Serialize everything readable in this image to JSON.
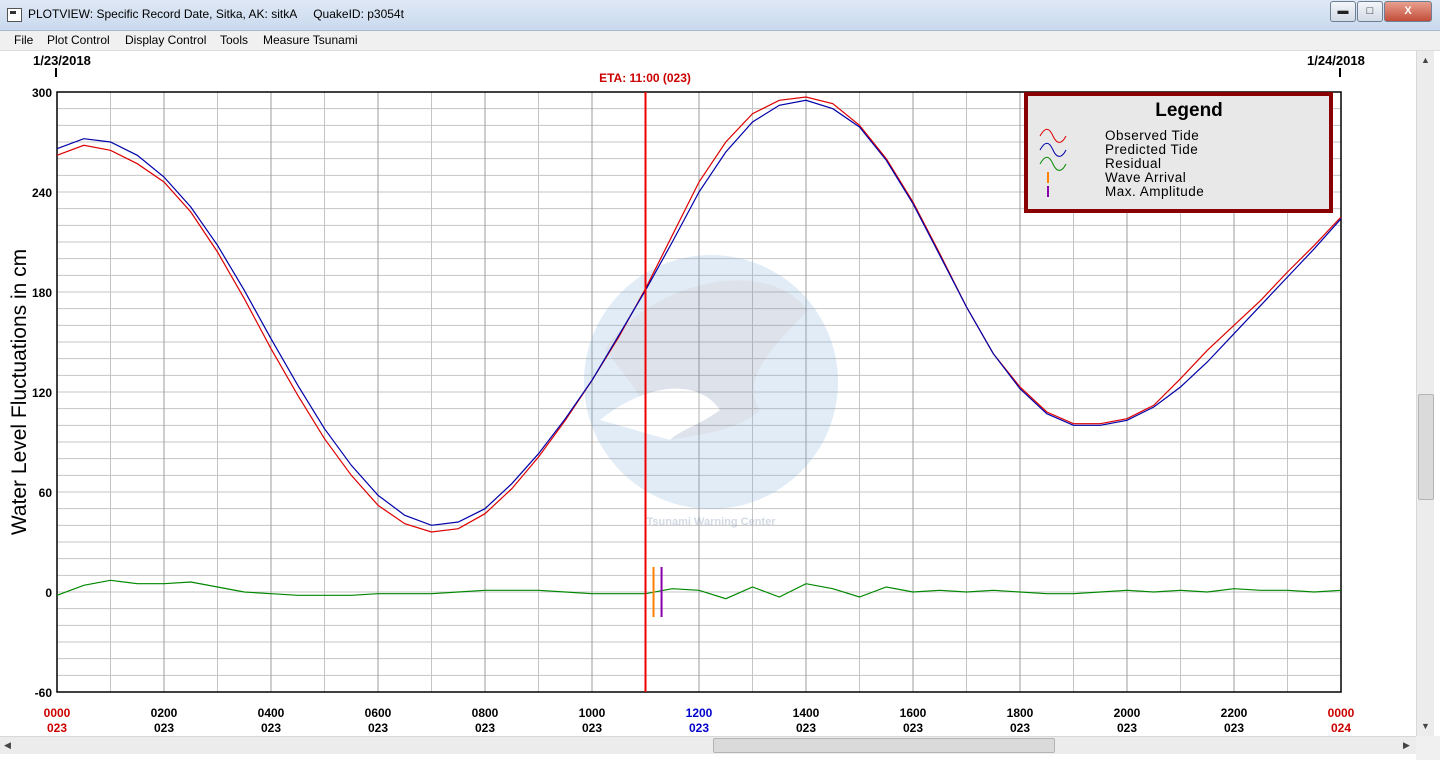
{
  "window": {
    "title": "PLOTVIEW: Specific Record Date, Sitka, AK: sitkA     QuakeID: p3054t",
    "minimize": "▬",
    "maximize": "□",
    "close": "X"
  },
  "menu": [
    "File",
    "Plot Control",
    "Display Control",
    "Tools",
    "Measure Tsunami"
  ],
  "chart_data": {
    "type": "line",
    "ylabel": "Water Level Fluctuations in cm",
    "ylim": [
      -60,
      300
    ],
    "y_ticks": [
      "300",
      "240",
      "180",
      "120",
      "60",
      "0",
      "-60"
    ],
    "x_range_hours": [
      0,
      24
    ],
    "start_date": "1/23/2018",
    "end_date": "1/24/2018",
    "eta_label": "ETA: 11:00 (023)",
    "eta_hour": 11,
    "x_ticks": [
      {
        "time": "0000",
        "day": "023",
        "hour": 0,
        "color": "#cc0000"
      },
      {
        "time": "0200",
        "day": "023",
        "hour": 2,
        "color": "#000000"
      },
      {
        "time": "0400",
        "day": "023",
        "hour": 4,
        "color": "#000000"
      },
      {
        "time": "0600",
        "day": "023",
        "hour": 6,
        "color": "#000000"
      },
      {
        "time": "0800",
        "day": "023",
        "hour": 8,
        "color": "#000000"
      },
      {
        "time": "1000",
        "day": "023",
        "hour": 10,
        "color": "#000000"
      },
      {
        "time": "1200",
        "day": "023",
        "hour": 12,
        "color": "#0000cc"
      },
      {
        "time": "1400",
        "day": "023",
        "hour": 14,
        "color": "#000000"
      },
      {
        "time": "1600",
        "day": "023",
        "hour": 16,
        "color": "#000000"
      },
      {
        "time": "1800",
        "day": "023",
        "hour": 18,
        "color": "#000000"
      },
      {
        "time": "2000",
        "day": "023",
        "hour": 20,
        "color": "#000000"
      },
      {
        "time": "2200",
        "day": "023",
        "hour": 22,
        "color": "#000000"
      },
      {
        "time": "0000",
        "day": "024",
        "hour": 24,
        "color": "#cc0000"
      }
    ],
    "legend": {
      "title": "Legend",
      "placement": "top-right",
      "items": [
        {
          "label": "Observed Tide",
          "color": "#dd0000",
          "marker": "wave"
        },
        {
          "label": "Predicted Tide",
          "color": "#0000aa",
          "marker": "wave"
        },
        {
          "label": "Residual",
          "color": "#008800",
          "marker": "wave"
        },
        {
          "label": "Wave Arrival",
          "color": "#ff8000",
          "marker": "bar"
        },
        {
          "label": "Max. Amplitude",
          "color": "#8800aa",
          "marker": "bar"
        }
      ]
    },
    "series": [
      {
        "name": "Observed Tide",
        "color": "#dd0000",
        "x": [
          0,
          0.5,
          1,
          1.5,
          2,
          2.5,
          3,
          3.5,
          4,
          4.5,
          5,
          5.5,
          6,
          6.5,
          7,
          7.5,
          8,
          8.5,
          9,
          9.5,
          10,
          10.5,
          11,
          11.5,
          12,
          12.5,
          13,
          13.5,
          14,
          14.5,
          15,
          15.5,
          16,
          16.5,
          17,
          17.5,
          18,
          18.5,
          19,
          19.5,
          20,
          20.5,
          21,
          21.5,
          22,
          22.5,
          23,
          23.5,
          24
        ],
        "y": [
          262,
          268,
          265,
          257,
          246,
          228,
          204,
          176,
          146,
          118,
          92,
          70,
          52,
          41,
          36,
          38,
          47,
          62,
          81,
          103,
          127,
          153,
          182,
          214,
          246,
          270,
          287,
          295,
          297,
          293,
          280,
          260,
          234,
          203,
          171,
          143,
          123,
          108,
          101,
          101,
          104,
          112,
          128,
          145,
          160,
          175,
          192,
          208,
          225
        ]
      },
      {
        "name": "Predicted Tide",
        "color": "#0000aa",
        "x": [
          0,
          0.5,
          1,
          1.5,
          2,
          2.5,
          3,
          3.5,
          4,
          4.5,
          5,
          5.5,
          6,
          6.5,
          7,
          7.5,
          8,
          8.5,
          9,
          9.5,
          10,
          10.5,
          11,
          11.5,
          12,
          12.5,
          13,
          13.5,
          14,
          14.5,
          15,
          15.5,
          16,
          16.5,
          17,
          17.5,
          18,
          18.5,
          19,
          19.5,
          20,
          20.5,
          21,
          21.5,
          22,
          22.5,
          23,
          23.5,
          24
        ],
        "y": [
          266,
          272,
          270,
          262,
          249,
          231,
          208,
          181,
          152,
          124,
          98,
          76,
          58,
          46,
          40,
          42,
          50,
          65,
          83,
          104,
          127,
          154,
          181,
          210,
          240,
          264,
          282,
          292,
          295,
          290,
          279,
          259,
          233,
          202,
          171,
          143,
          122,
          107,
          100,
          100,
          103,
          111,
          123,
          138,
          155,
          172,
          189,
          206,
          224
        ]
      },
      {
        "name": "Residual",
        "color": "#008800",
        "x": [
          0,
          0.5,
          1,
          1.5,
          2,
          2.5,
          3,
          3.5,
          4,
          4.5,
          5,
          5.5,
          6,
          6.5,
          7,
          7.5,
          8,
          8.5,
          9,
          9.5,
          10,
          10.5,
          11,
          11.5,
          12,
          12.5,
          13,
          13.5,
          14,
          14.5,
          15,
          15.5,
          16,
          16.5,
          17,
          17.5,
          18,
          18.5,
          19,
          19.5,
          20,
          20.5,
          21,
          21.5,
          22,
          22.5,
          23,
          23.5,
          24
        ],
        "y": [
          -2,
          4,
          7,
          5,
          5,
          6,
          3,
          0,
          -1,
          -2,
          -2,
          -2,
          -1,
          -1,
          -1,
          0,
          1,
          1,
          1,
          0,
          -1,
          -1,
          -1,
          2,
          1,
          -4,
          3,
          -3,
          5,
          2,
          -3,
          3,
          0,
          1,
          0,
          1,
          0,
          -1,
          -1,
          0,
          1,
          0,
          1,
          0,
          2,
          1,
          1,
          0,
          1
        ]
      }
    ],
    "wave_arrival_hour": 11.15,
    "max_amplitude_hour": 11.3
  },
  "watermark_text": "Tsunami Warning Center"
}
